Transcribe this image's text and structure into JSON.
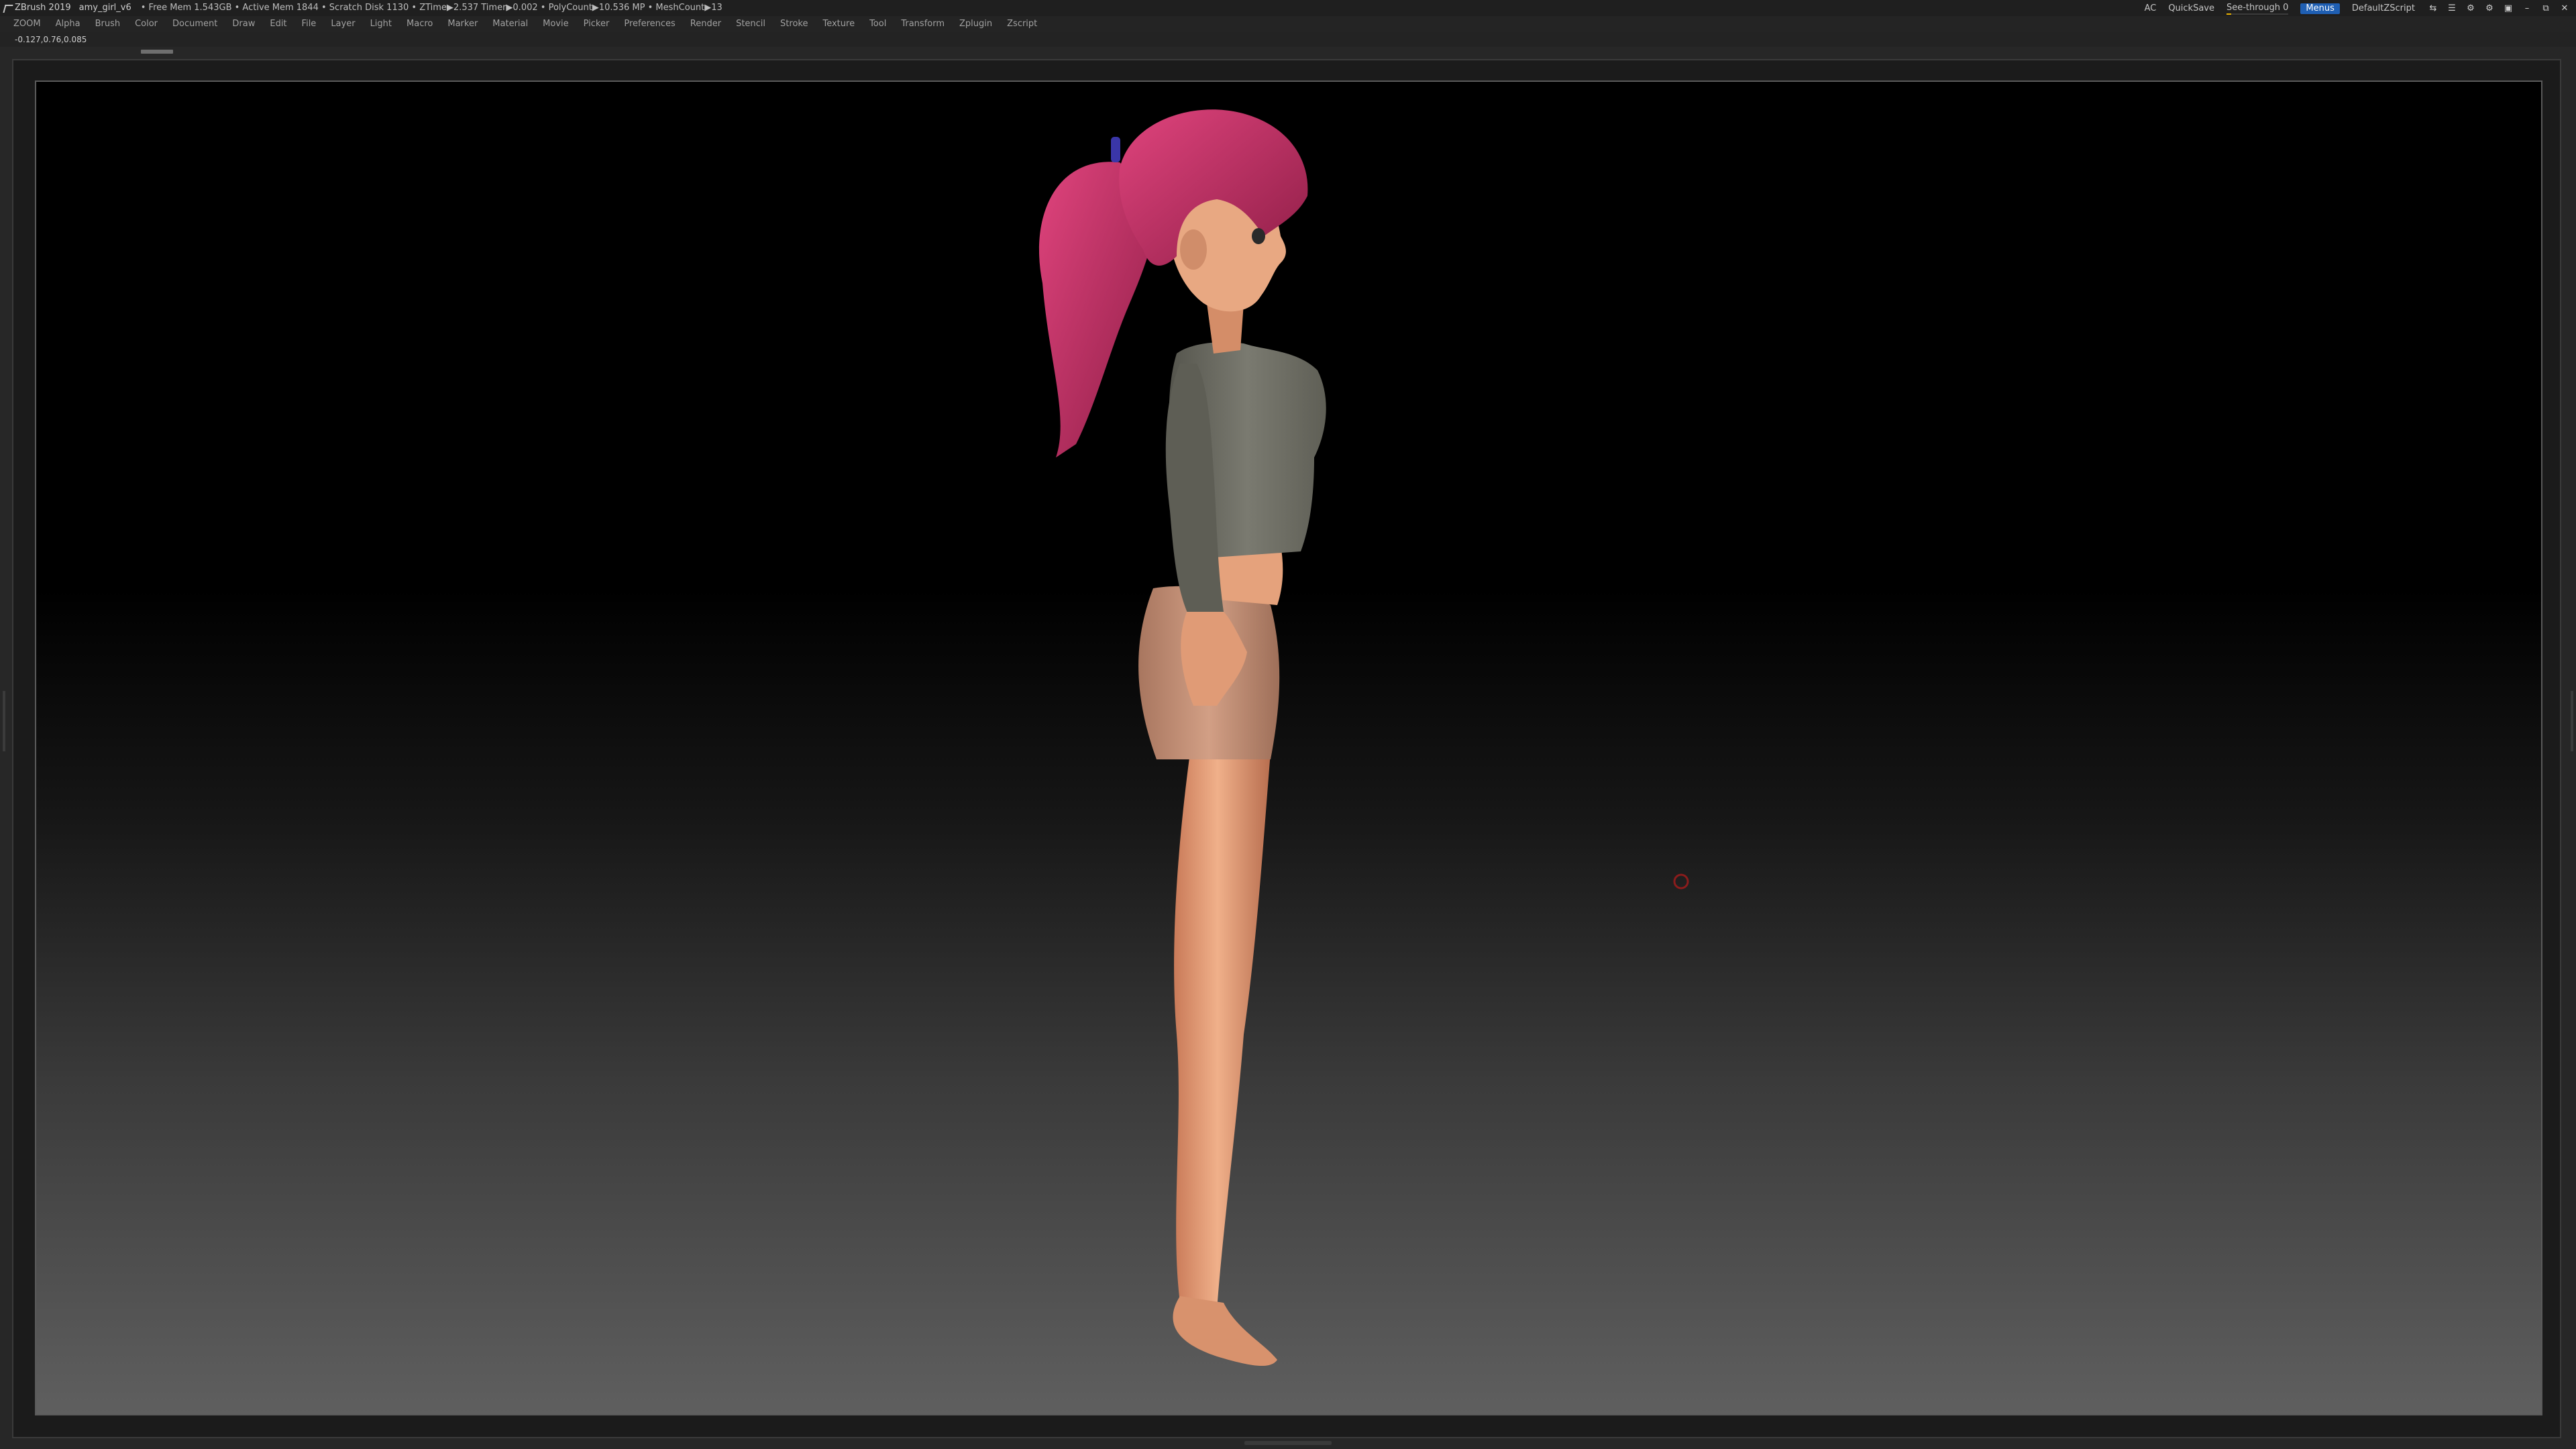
{
  "titlebar": {
    "app_name": "ZBrush 2019",
    "document_name": "amy_girl_v6",
    "stats": "• Free Mem 1.543GB • Active Mem 1844 • Scratch Disk 1130 • ZTime▶2.537 Timer▶0.002 • PolyCount▶10.536 MP • MeshCount▶13",
    "ac_label": "AC",
    "quicksave_label": "QuickSave",
    "see_through_label": "See-through  0",
    "see_through_value": 0,
    "menus_label": "Menus",
    "script_label": "DefaultZScript"
  },
  "menubar": {
    "items": [
      "ZOOM",
      "Alpha",
      "Brush",
      "Color",
      "Document",
      "Draw",
      "Edit",
      "File",
      "Layer",
      "Light",
      "Macro",
      "Marker",
      "Material",
      "Movie",
      "Picker",
      "Preferences",
      "Render",
      "Stencil",
      "Stroke",
      "Texture",
      "Tool",
      "Transform",
      "Zplugin",
      "Zscript"
    ]
  },
  "inforow": {
    "coords": "-0.127,0.76,0.085"
  },
  "colors": {
    "hair": "#c8336a",
    "skin": "#e8a07a",
    "shirt": "#6d6d63",
    "shorts": "#c8957a",
    "hair_tie": "#3a36a8",
    "cursor_ring": "#8a1c1c",
    "accent_blue": "#1f5fb3",
    "see_through_fill": "#e8b000"
  }
}
